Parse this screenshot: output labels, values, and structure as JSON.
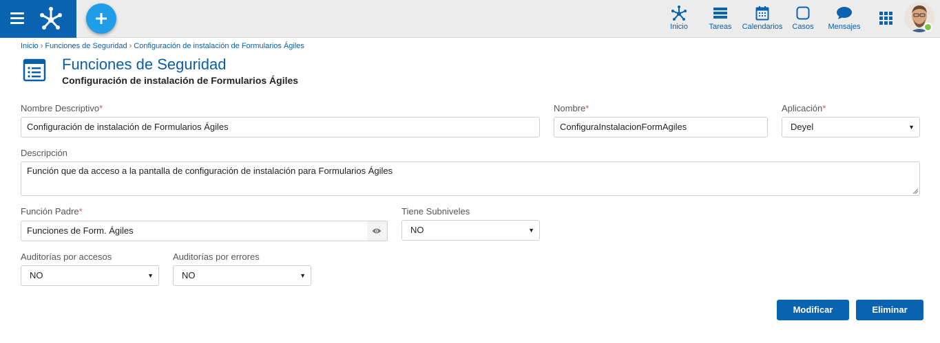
{
  "header": {
    "nav": [
      {
        "label": "Inicio",
        "icon": "network-icon"
      },
      {
        "label": "Tareas",
        "icon": "tasks-icon"
      },
      {
        "label": "Calendarios",
        "icon": "calendar-icon"
      },
      {
        "label": "Casos",
        "icon": "cases-icon"
      },
      {
        "label": "Mensajes",
        "icon": "message-icon"
      }
    ],
    "brand_color": "#0a63b0",
    "add_button_color": "#1f9ee8",
    "status_color": "#7dc443"
  },
  "breadcrumb": [
    "Inicio",
    "Funciones de Seguridad",
    "Configuración de instalación de Formularios Ágiles"
  ],
  "page": {
    "title": "Funciones de Seguridad",
    "subtitle": "Configuración de instalación de Formularios Ágiles"
  },
  "form": {
    "nombre_descriptivo": {
      "label": "Nombre Descriptivo",
      "required_mark": "*",
      "value": "Configuración de instalación de Formularios Ágiles"
    },
    "nombre": {
      "label": "Nombre",
      "required_mark": "*",
      "value": "ConfiguraInstalacionFormAgiles"
    },
    "aplicacion": {
      "label": "Aplicación",
      "required_mark": "*",
      "value": "Deyel"
    },
    "descripcion": {
      "label": "Descripción",
      "value": "Función que da acceso a la pantalla de configuración de instalación para Formularios Ágiles"
    },
    "funcion_padre": {
      "label": "Función Padre",
      "required_mark": "*",
      "value": "Funciones de Form. Ágiles"
    },
    "tiene_subniveles": {
      "label": "Tiene Subniveles",
      "value": "NO"
    },
    "auditorias_accesos": {
      "label": "Auditorías por accesos",
      "value": "NO"
    },
    "auditorias_errores": {
      "label": "Auditorías por errores",
      "value": "NO"
    }
  },
  "actions": {
    "modify_label": "Modificar",
    "delete_label": "Eliminar"
  }
}
